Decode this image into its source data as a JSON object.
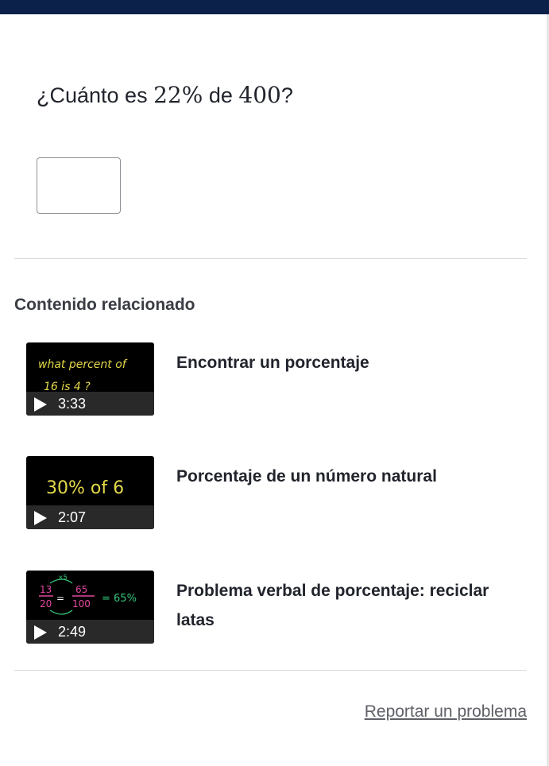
{
  "question": {
    "prefix": "¿Cuánto es",
    "percent": "22%",
    "middle": "de",
    "number": "400",
    "suffix": "?"
  },
  "answer": {
    "value": ""
  },
  "related": {
    "title": "Contenido relacionado",
    "videos": [
      {
        "title": "Encontrar un porcentaje",
        "duration": "3:33",
        "thumb_text": [
          "what percent of",
          "16 is 4 ?"
        ]
      },
      {
        "title": "Porcentaje de un número natural",
        "duration": "2:07",
        "thumb_text": [
          "30% of 6"
        ]
      },
      {
        "title": "Problema verbal de porcentaje: reciclar latas",
        "duration": "2:49",
        "thumb_text": [
          "13",
          "20",
          "65",
          "100",
          "= 65%",
          "×5"
        ]
      }
    ]
  },
  "report": {
    "label": "Reportar un problema"
  },
  "colors": {
    "topbar": "#0b2149",
    "thumb_yellow": "#e3d84a",
    "thumb_pink": "#e0479e",
    "thumb_green": "#35c77a"
  }
}
